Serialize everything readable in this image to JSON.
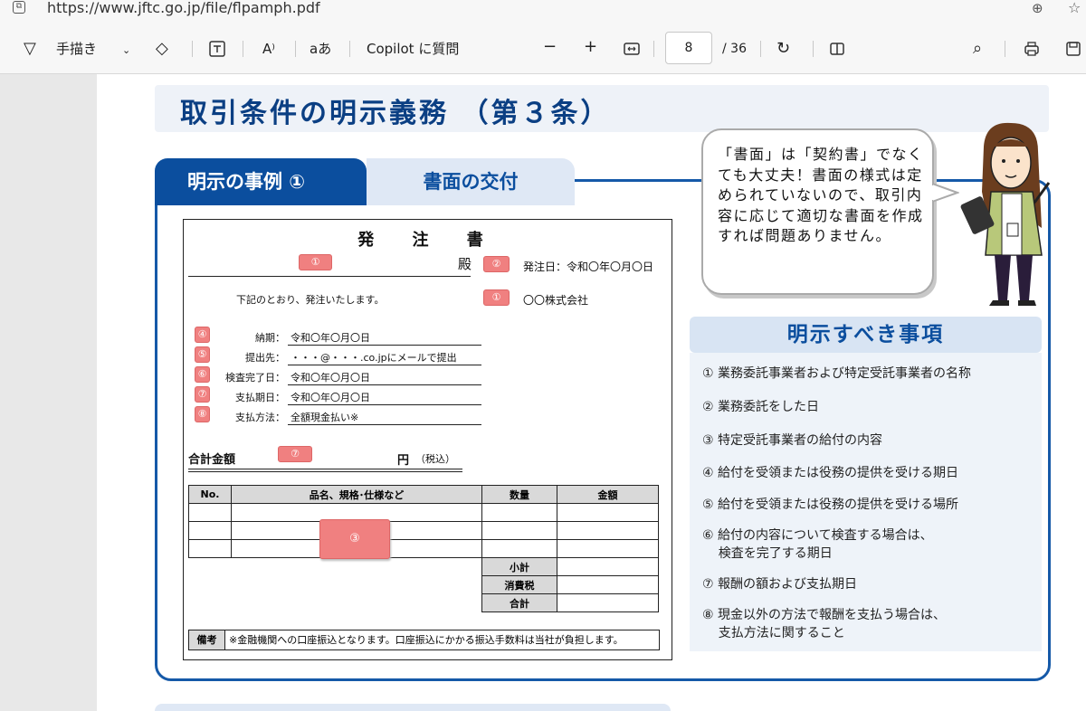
{
  "browser": {
    "url": "https://www.jftc.go.jp/file/flpamph.pdf"
  },
  "pdf_toolbar": {
    "draw_label": "手描き",
    "read_aloud_label": "A⁾",
    "translate_label": "aあ",
    "copilot_label": "Copilot に質問",
    "page_current": "8",
    "page_total": "/ 36"
  },
  "page": {
    "title": "取引条件の明示義務 （第３条）",
    "tab_example": "明示の事例 ①",
    "tab_delivery": "書面の交付",
    "order_form": {
      "title": "発 注 書",
      "dono": "殿",
      "order_date": "発注日：令和〇年〇月〇日",
      "intro": "下記のとおり、発注いたします。",
      "company": "〇〇株式会社",
      "delivery_label": "納期：",
      "delivery_value": "令和〇年〇月〇日",
      "place_label": "提出先：",
      "place_value": "・・・@・・・.co.jpにメールで提出",
      "inspect_label": "検査完了日：",
      "inspect_value": "令和〇年〇月〇日",
      "paydate_label": "支払期日：",
      "paydate_value": "令和〇年〇月〇日",
      "paymethod_label": "支払方法：",
      "paymethod_value": "全額現金払い※",
      "total_label": "合計金額",
      "yen": "円",
      "tax_incl": "（税込）",
      "columns": [
        "No.",
        "品名、規格･仕様など",
        "数量",
        "金額"
      ],
      "subtotal": "小計",
      "tax": "消費税",
      "grand_total": "合計",
      "note_label": "備考",
      "note_text": "※金融機関への口座振込となります。口座振込にかかる振込手数料は当社が負担します。",
      "badges": {
        "b1": "①",
        "b2": "②",
        "b3": "③",
        "b4": "④",
        "b5": "⑤",
        "b6": "⑥",
        "b7": "⑦",
        "b8": "⑧"
      }
    },
    "bubble": "「書面」は「契約書」でなくても大丈夫！書面の様式は定められていないので、取引内容に応じて適切な書面を作成すれば問題ありません。",
    "meiji_heading": "明示すべき事項",
    "meiji_items": [
      "① 業務委託事業者および特定受託事業者の名称",
      "② 業務委託をした日",
      "③ 特定受託事業者の給付の内容",
      "④ 給付を受領または役務の提供を受ける期日",
      "⑤ 給付を受領または役務の提供を受ける場所",
      "⑥ 給付の内容について検査する場合は、\n    検査を完了する期日",
      "⑦ 報酬の額および支払期日",
      "⑧ 現金以外の方法で報酬を支払う場合は、\n    支払方法に関すること"
    ]
  },
  "colors": {
    "primary": "#0b4e9e",
    "title": "#0b3f83",
    "badge": "#f08080",
    "light_blue": "#dfe8f5"
  }
}
